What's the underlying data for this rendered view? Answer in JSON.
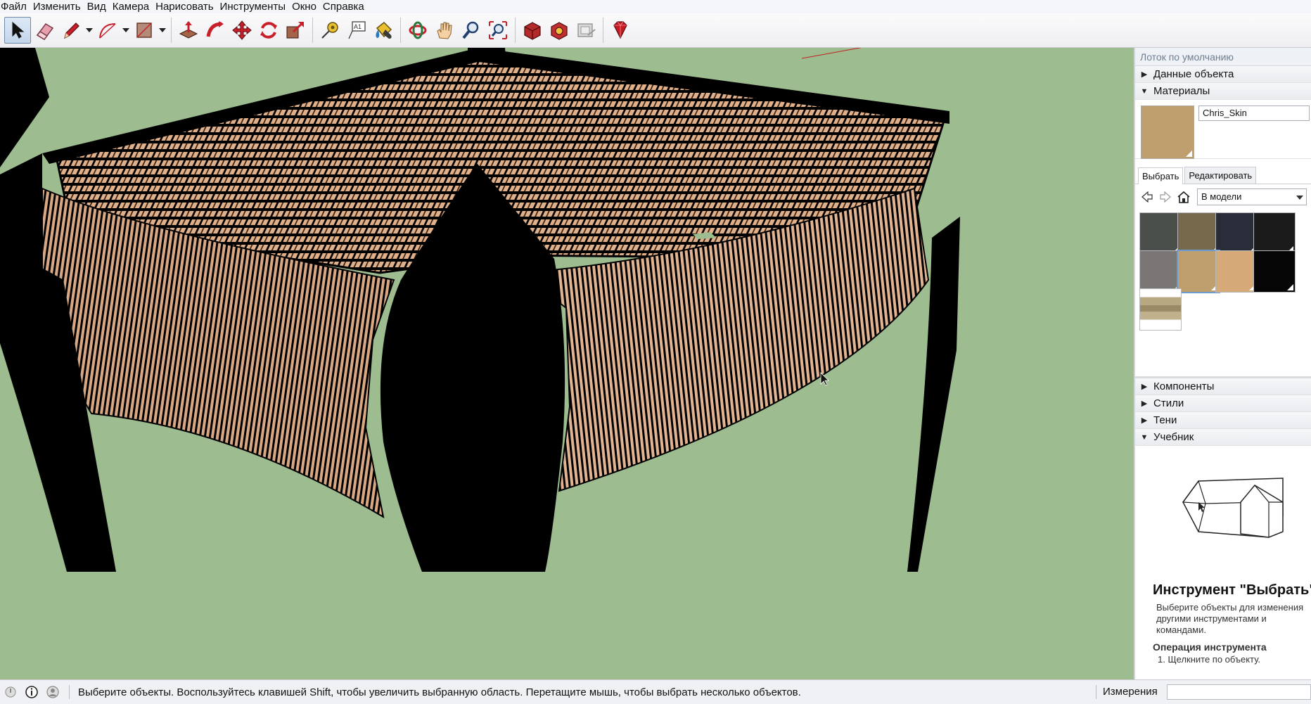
{
  "menu": {
    "file": "Файл",
    "edit": "Изменить",
    "view": "Вид",
    "camera": "Камера",
    "draw": "Нарисовать",
    "tools": "Инструменты",
    "window": "Окно",
    "help": "Справка"
  },
  "toolbar": {
    "icons": [
      "select-icon",
      "eraser-icon",
      "pencil-icon",
      "arc-icon",
      "rectangle-icon",
      "pushpull-icon",
      "followme-icon",
      "move-icon",
      "rotate-icon",
      "scale-icon",
      "tape-measure-icon",
      "text-icon",
      "paint-bucket-icon",
      "orbit-icon",
      "pan-icon",
      "zoom-icon",
      "zoom-extents-icon",
      "warehouse-icon",
      "extension-warehouse-icon",
      "layout-icon",
      "ruby-icon"
    ],
    "text_icon_label": "A1"
  },
  "tray": {
    "title": "Лоток по умолчанию",
    "entity_info": "Данные объекта",
    "materials": "Материалы",
    "material_name": "Chris_Skin",
    "tab_select": "Выбрать",
    "tab_edit": "Редактировать",
    "library_select": "В модели",
    "swatches": [
      "#4a4f4c",
      "#76694c",
      "#2a2c3a",
      "#1c1b1c",
      "#7a7676",
      "#c09f6f",
      "#d6a979",
      "#050505",
      "wood-texture"
    ],
    "components": "Компоненты",
    "styles": "Стили",
    "shadows": "Тени",
    "instructor": "Учебник",
    "tool_title": "Инструмент \"Выбрать\"",
    "tool_desc": "Выберите объекты для изменения другими инструментами и командами.",
    "operation_title": "Операция инструмента",
    "operation_step": "1. Щелкните по объекту."
  },
  "status": {
    "message": "Выберите объекты. Воспользуйтесь клавишей Shift, чтобы увеличить выбранную область. Перетащите мышь, чтобы выбрать несколько объектов.",
    "measurements_label": "Измерения",
    "measurements_value": ""
  },
  "colors": {
    "background": "#9dbc90",
    "weave": "#d9a883",
    "frame": "#000000",
    "selected_material": "#c09f6f"
  }
}
